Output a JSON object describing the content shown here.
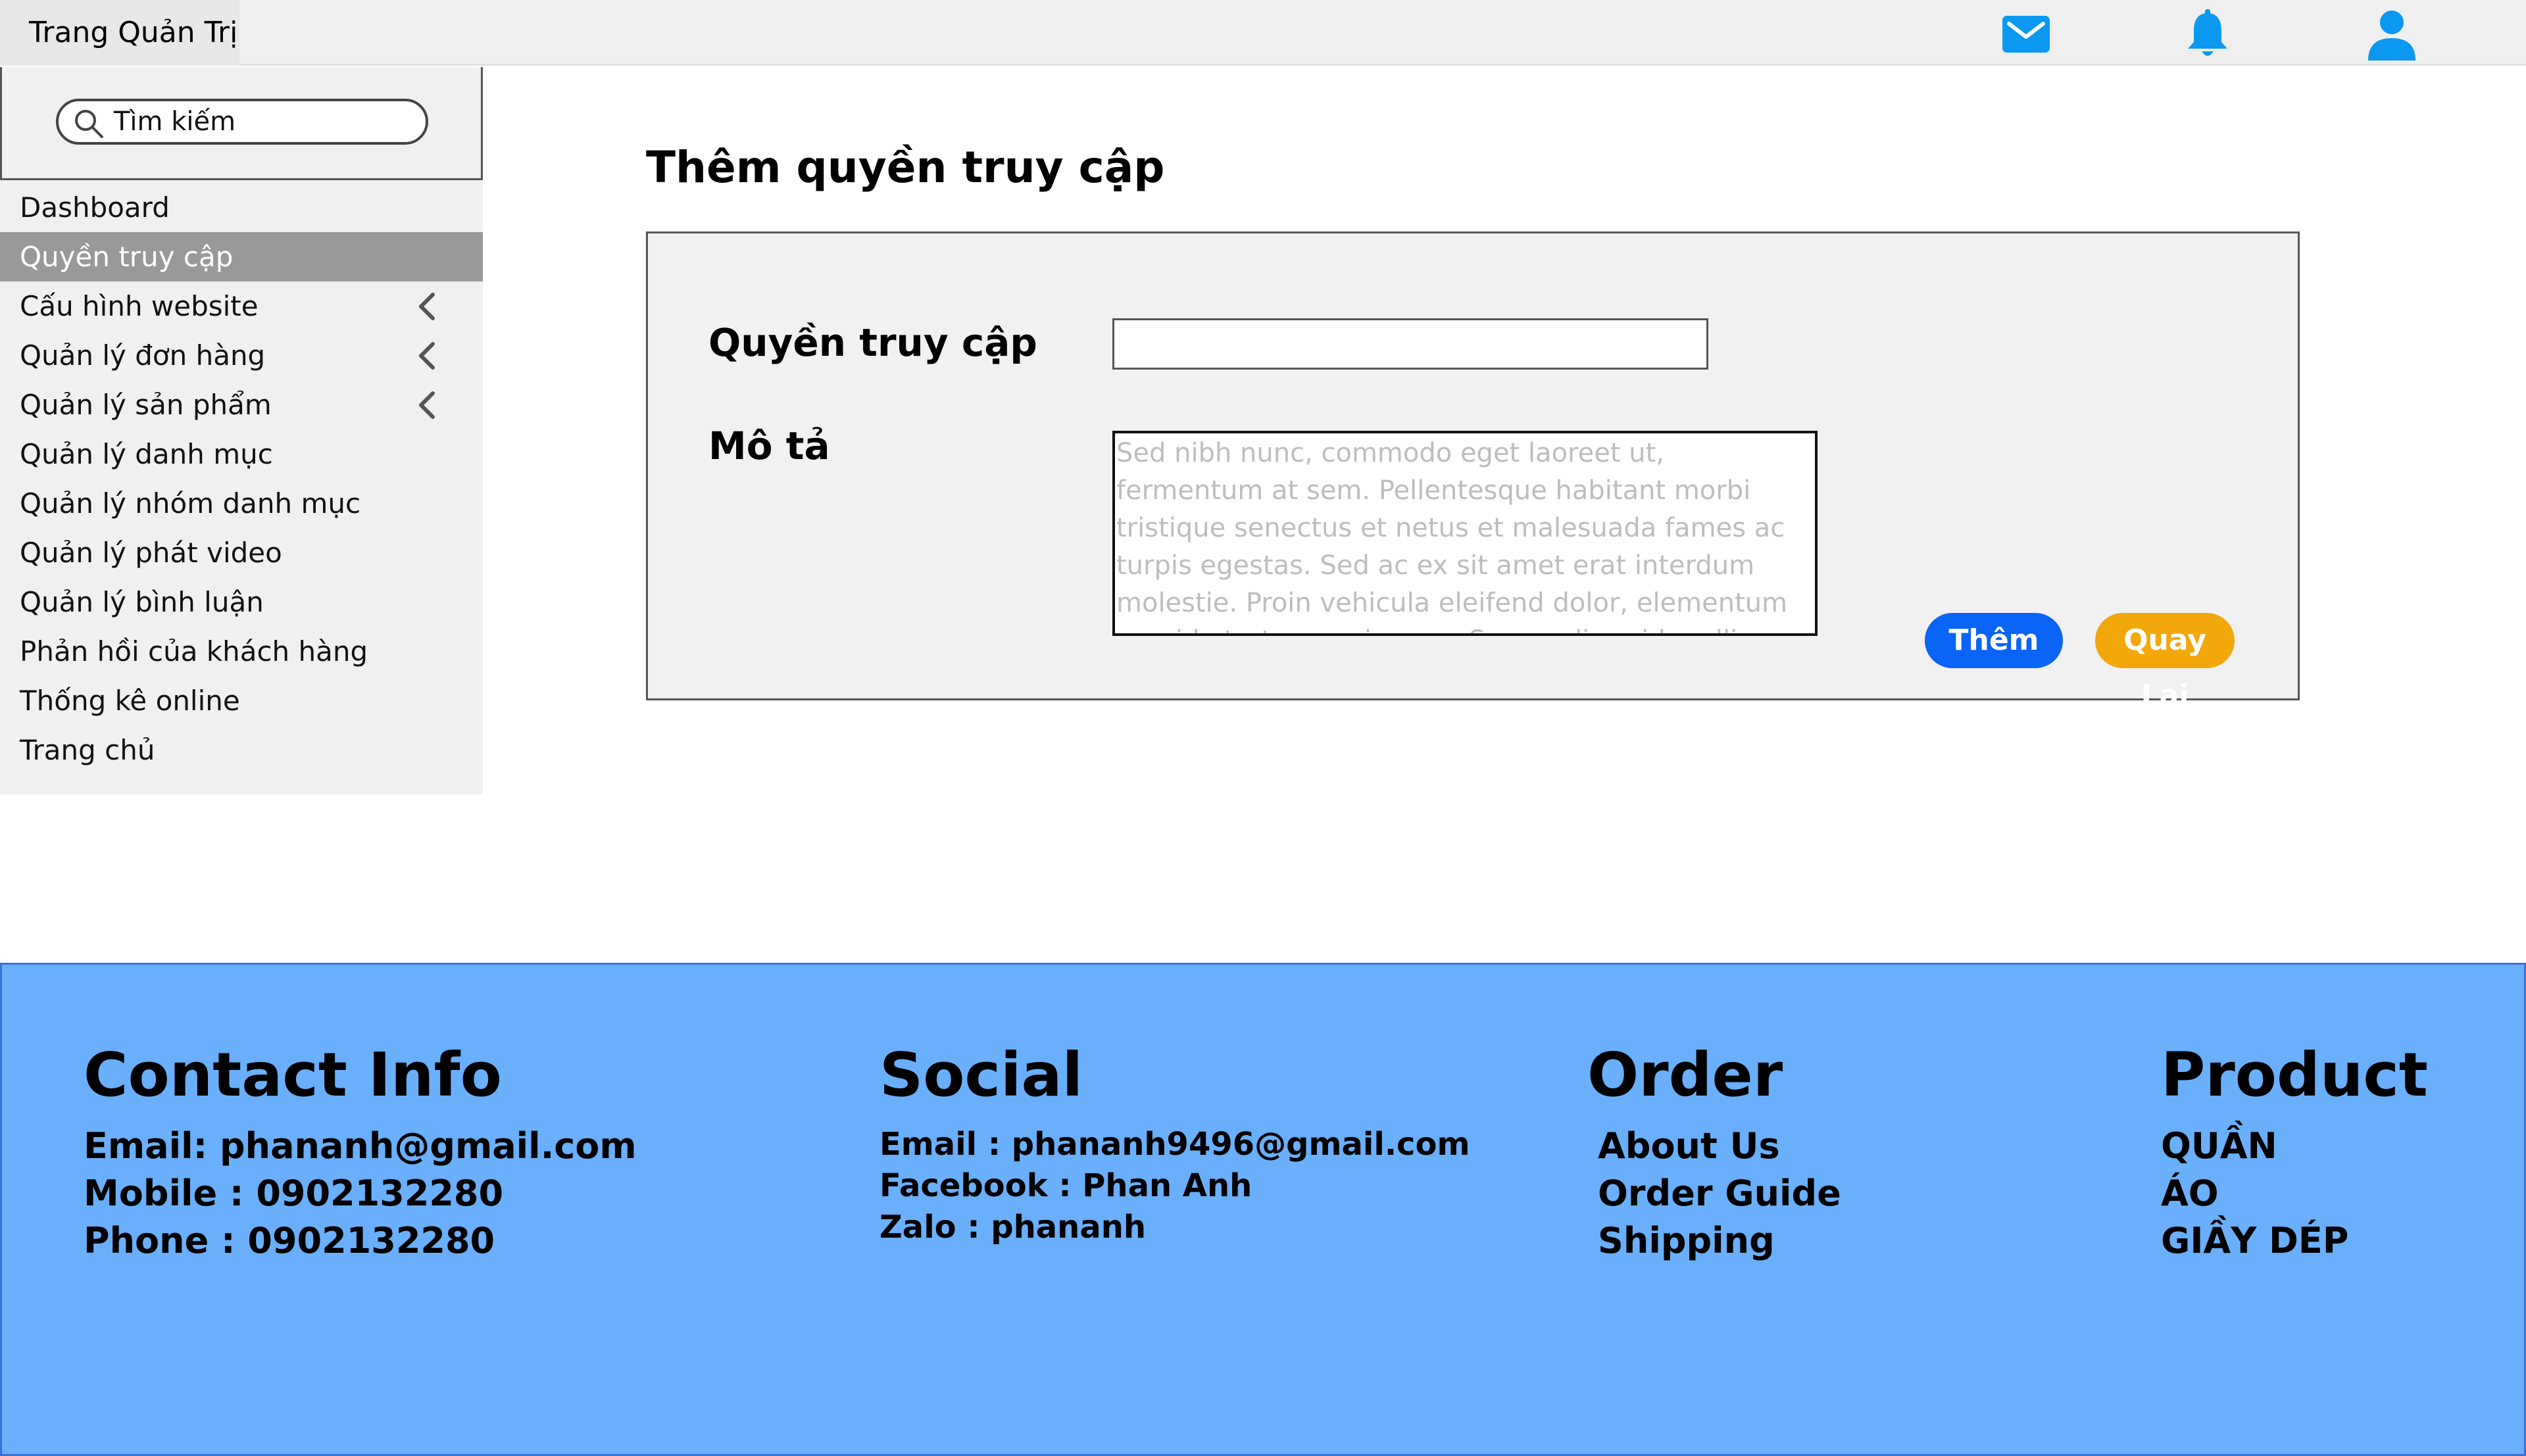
{
  "header": {
    "app_title": "Trang Quản Trị",
    "icons": [
      "mail-icon",
      "bell-icon",
      "user-icon"
    ],
    "icon_color": "#0b98f0"
  },
  "sidebar": {
    "search_placeholder": "Tìm kiếm",
    "items": [
      {
        "label": "Dashboard",
        "has_submenu": false,
        "active": false
      },
      {
        "label": "Quyền truy cập",
        "has_submenu": false,
        "active": true
      },
      {
        "label": "Cấu hình website",
        "has_submenu": true,
        "active": false
      },
      {
        "label": "Quản lý đơn hàng",
        "has_submenu": true,
        "active": false
      },
      {
        "label": "Quản lý sản phẩm",
        "has_submenu": true,
        "active": false
      },
      {
        "label": "Quản lý danh mục",
        "has_submenu": false,
        "active": false
      },
      {
        "label": "Quản lý nhóm danh mục",
        "has_submenu": false,
        "active": false
      },
      {
        "label": "Quản lý phát video",
        "has_submenu": false,
        "active": false
      },
      {
        "label": "Quản lý bình luận",
        "has_submenu": false,
        "active": false
      },
      {
        "label": "Phản hồi của khách hàng",
        "has_submenu": false,
        "active": false
      },
      {
        "label": "Thống kê online",
        "has_submenu": false,
        "active": false
      },
      {
        "label": "Trang chủ",
        "has_submenu": false,
        "active": false
      }
    ]
  },
  "main": {
    "page_title": "Thêm quyền truy cập",
    "form": {
      "permission_label": "Quyền truy cập",
      "permission_value": "",
      "description_label": "Mô tả",
      "description_placeholder": "Sed nibh nunc, commodo eget laoreet ut, fermentum at sem. Pellentesque habitant morbi tristique senectus et netus et malesuada fames ac turpis egestas. Sed ac ex sit amet erat interdum molestie. Proin vehicula eleifend dolor, elementum gravida tortor maximus a. Suspendisse id mollis tortor, id molestie lorem. Vivamus at vulputate ligula, quis convallis nibh.",
      "add_button": "Thêm",
      "back_button": "Quay Lại",
      "add_color": "#0a64f5",
      "back_color": "#f2a70a"
    }
  },
  "footer": {
    "background": "#6aaffb",
    "contact": {
      "heading": "Contact Info",
      "lines": [
        "Email: phananh@gmail.com",
        "Mobile : 0902132280",
        "Phone : 0902132280"
      ]
    },
    "social": {
      "heading": "Social",
      "lines": [
        "Email : phananh9496@gmail.com",
        "Facebook : Phan Anh",
        "Zalo : phananh"
      ]
    },
    "order": {
      "heading": "Order",
      "lines": [
        "About Us",
        "Order Guide",
        "Shipping"
      ]
    },
    "product": {
      "heading": "Product",
      "lines": [
        "QUẦN",
        "ÁO",
        "GIẦY DÉP"
      ]
    }
  }
}
